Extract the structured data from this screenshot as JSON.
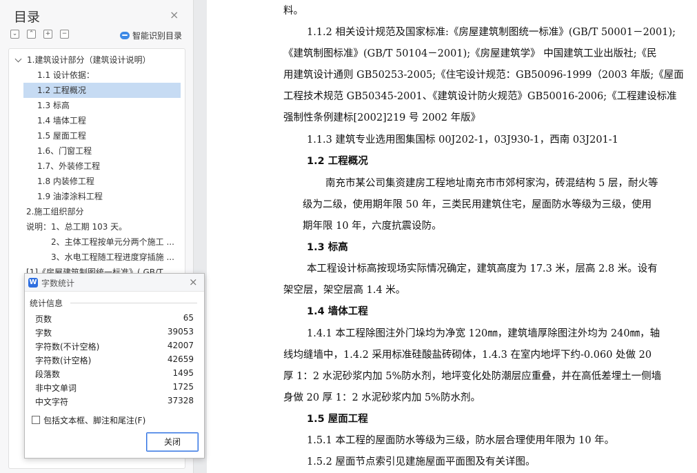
{
  "nav": {
    "title": "目录",
    "close": "×",
    "tools": [
      "⌄",
      "⌃",
      "+",
      "−"
    ],
    "smart_toc": "智能识别目录",
    "items": [
      {
        "label": "1.建筑设计部分（建筑设计说明）",
        "level": 0,
        "expanded": true
      },
      {
        "label": "1.1 设计依据：",
        "level": 1
      },
      {
        "label": "1.2 工程概况",
        "level": 1,
        "selected": true
      },
      {
        "label": "1.3 标高",
        "level": 1
      },
      {
        "label": "1.4 墙体工程",
        "level": 1
      },
      {
        "label": "1.5 屋面工程",
        "level": 1
      },
      {
        "label": "1.6、门窗工程",
        "level": 1
      },
      {
        "label": "1.7、外装修工程",
        "level": 1
      },
      {
        "label": "1.8 内装修工程",
        "level": 1
      },
      {
        "label": "1.9 油漆涂料工程",
        "level": 1
      },
      {
        "label": "2.施工组织部分",
        "level": 0
      },
      {
        "label": "说明：1、总工期 103 天。",
        "level": 0
      },
      {
        "label": "2、主体工程按单元分两个施工 ...",
        "level": 2
      },
      {
        "label": "3、水电工程随工程进度穿插施 ...",
        "level": 2
      },
      {
        "label": "[1]《房屋建筑制图统一标准》( GB/T ...",
        "level": 0
      }
    ]
  },
  "document": {
    "lines": [
      {
        "text": "料。"
      },
      {
        "text": "1.1.2 相关设计规范及国家标准:《房屋建筑制图统一标准》(GB/T 50001－2001);"
      },
      {
        "text": "《建筑制图标准》(GB/T 50104－2001);《房屋建筑学》 中国建筑工业出版社;《民"
      },
      {
        "text": "用建筑设计通则 GB50253-2005;《住宅设计规范：GB50096-1999（2003 年版;《屋面"
      },
      {
        "text": "工程技术规范 GB50345-2001、《建筑设计防火规范》GB50016-2006;《工程建设标准"
      },
      {
        "text": "强制性条例建标[2002]219 号 2002 年版》"
      },
      {
        "text": "1.1.3 建筑专业选用图集国标 00J202-1，03J930-1，西南 03J201-1"
      },
      {
        "text": "1.2 工程概况",
        "heading": true
      },
      {
        "text": "南充市某公司集资建房工程地址南充市市郊柯家沟，砖混结构 5 层，耐火等"
      },
      {
        "text": "级为二级，使用期年限 50 年，三类民用建筑住宅，屋面防水等级为三级，使用"
      },
      {
        "text": "期年限 10 年，六度抗震设防。"
      },
      {
        "text": "1.3 标高",
        "heading": true
      },
      {
        "text": "本工程设计标高按现场实际情况确定，建筑高度为 17.3 米，层高 2.8 米。设有"
      },
      {
        "text": "架空层，架空层高 1.4 米。"
      },
      {
        "text": "1.4 墙体工程",
        "heading": true
      },
      {
        "text": "1.4.1 本工程除图注外门垛均为净宽 120㎜，建筑墙厚除图注外均为 240㎜，轴"
      },
      {
        "text": "线均缝墙中，1.4.2 采用标准硅酸盐砖砌体，1.4.3 在室内地坪下约-0.060 处做 20"
      },
      {
        "text": "厚 1：2 水泥砂浆内加 5%防水剂，地坪变化处防潮层应重叠，并在高低差埋土一侧墙"
      },
      {
        "text": "身做 20 厚 1：2 水泥砂浆内加 5%防水剂。"
      },
      {
        "text": "1.5 屋面工程",
        "heading": true
      },
      {
        "text": "1.5.1 本工程的屋面防水等级为三级，防水层合理使用年限为 10 年。"
      },
      {
        "text": "1.5.2 屋面节点索引见建施屋面平面图及有关详图。"
      }
    ]
  },
  "dialog": {
    "title": "字数统计",
    "logo": "W",
    "close": "×",
    "section": "统计信息",
    "stats": [
      {
        "label": "页数",
        "value": "65"
      },
      {
        "label": "字数",
        "value": "39053"
      },
      {
        "label": "字符数(不计空格)",
        "value": "42007"
      },
      {
        "label": "字符数(计空格)",
        "value": "42659"
      },
      {
        "label": "段落数",
        "value": "1495"
      },
      {
        "label": "非中文单词",
        "value": "1725"
      },
      {
        "label": "中文字符",
        "value": "37328"
      }
    ],
    "checkbox_label": "包括文本框、脚注和尾注(F)",
    "checkbox_checked": false,
    "close_button": "关闭"
  }
}
